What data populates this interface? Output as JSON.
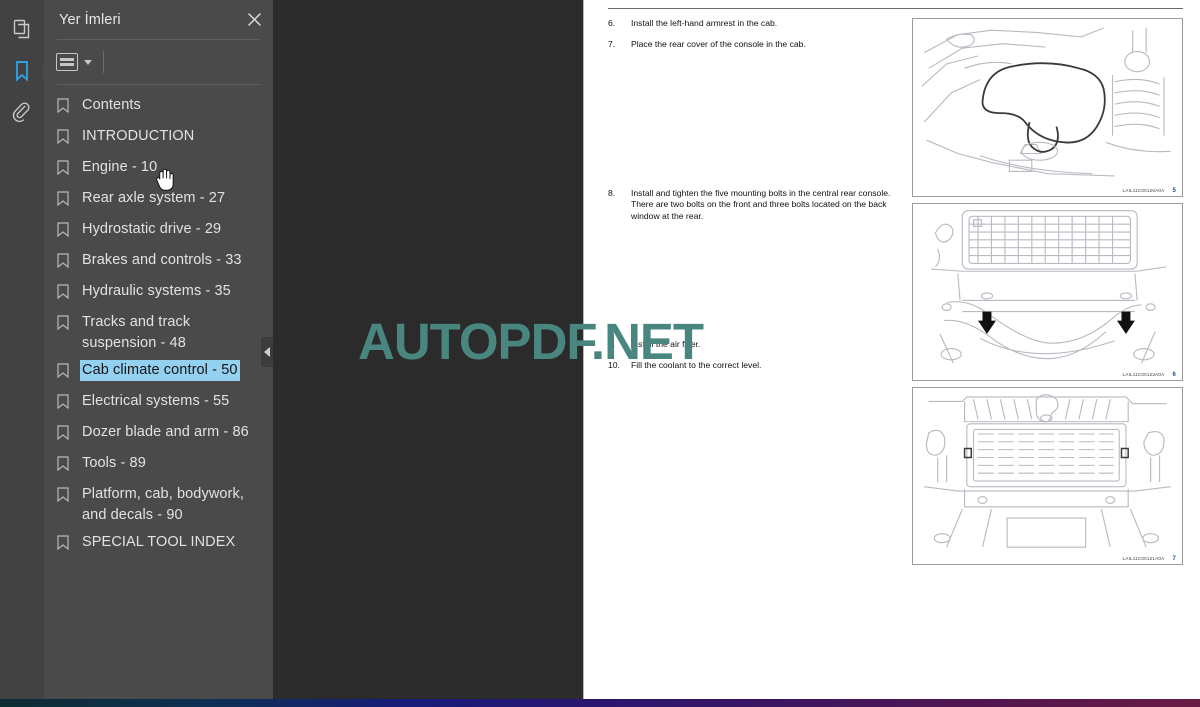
{
  "rail": {
    "items": [
      {
        "name": "page-thumbnails-icon",
        "label": "Sayfa Küçük Resimleri",
        "active": false
      },
      {
        "name": "bookmarks-icon",
        "label": "Yer İmleri",
        "active": true
      },
      {
        "name": "attachments-icon",
        "label": "Ekler",
        "active": false
      }
    ]
  },
  "panel": {
    "title": "Yer İmleri",
    "close_label": "✕",
    "toolbar": {
      "list_options_label": "Seçenekler",
      "caret_label": "▾"
    },
    "bookmarks": [
      {
        "label": "Contents",
        "selected": false
      },
      {
        "label": "INTRODUCTION",
        "selected": false
      },
      {
        "label": "Engine - 10",
        "selected": false
      },
      {
        "label": "Rear axle system - 27",
        "selected": false
      },
      {
        "label": "Hydrostatic drive - 29",
        "selected": false
      },
      {
        "label": "Brakes and controls - 33",
        "selected": false
      },
      {
        "label": "Hydraulic systems - 35",
        "selected": false
      },
      {
        "label": "Tracks and track suspension - 48",
        "selected": false
      },
      {
        "label": "Cab climate control - 50",
        "selected": true
      },
      {
        "label": "Electrical systems - 55",
        "selected": false
      },
      {
        "label": "Dozer blade and arm - 86",
        "selected": false
      },
      {
        "label": "Tools - 89",
        "selected": false
      },
      {
        "label": "Platform, cab, bodywork, and decals - 90",
        "selected": false
      },
      {
        "label": "SPECIAL TOOL INDEX",
        "selected": false
      }
    ],
    "collapse_handle_label": "◀"
  },
  "document": {
    "steps_top": [
      {
        "num": "6.",
        "text": "Install the left-hand armrest in the cab."
      },
      {
        "num": "7.",
        "text": "Place the rear cover of the console in the cab."
      }
    ],
    "steps_mid": [
      {
        "num": "8.",
        "text": "Install and tighten the five mounting bolts in the central rear console.  There are two bolts on the front and three bolts located on the back window at the rear."
      }
    ],
    "steps_bottom": [
      {
        "num": "9.",
        "text": "Install the air filter."
      },
      {
        "num": "10.",
        "text": "Fill the coolant to the correct level."
      }
    ],
    "figures": [
      {
        "caption": "LAIL11C00126A0A",
        "number": "5",
        "alt": "cab console rear cover illustration"
      },
      {
        "caption": "LAIL11C00123A0A",
        "number": "6",
        "alt": "rear window grille with two bolt arrows"
      },
      {
        "caption": "LAIL11C00121A0A",
        "number": "7",
        "alt": "air filter grille panel"
      }
    ]
  },
  "watermark": {
    "text": "AUTOPDF.NET",
    "color": "#49867f"
  },
  "colors": {
    "rail_bg": "#424242",
    "panel_bg": "#4a4a4a",
    "viewer_bg": "#2b2b2b",
    "accent_blue": "#2e9fe0",
    "selection_blue": "#94d0f0"
  }
}
